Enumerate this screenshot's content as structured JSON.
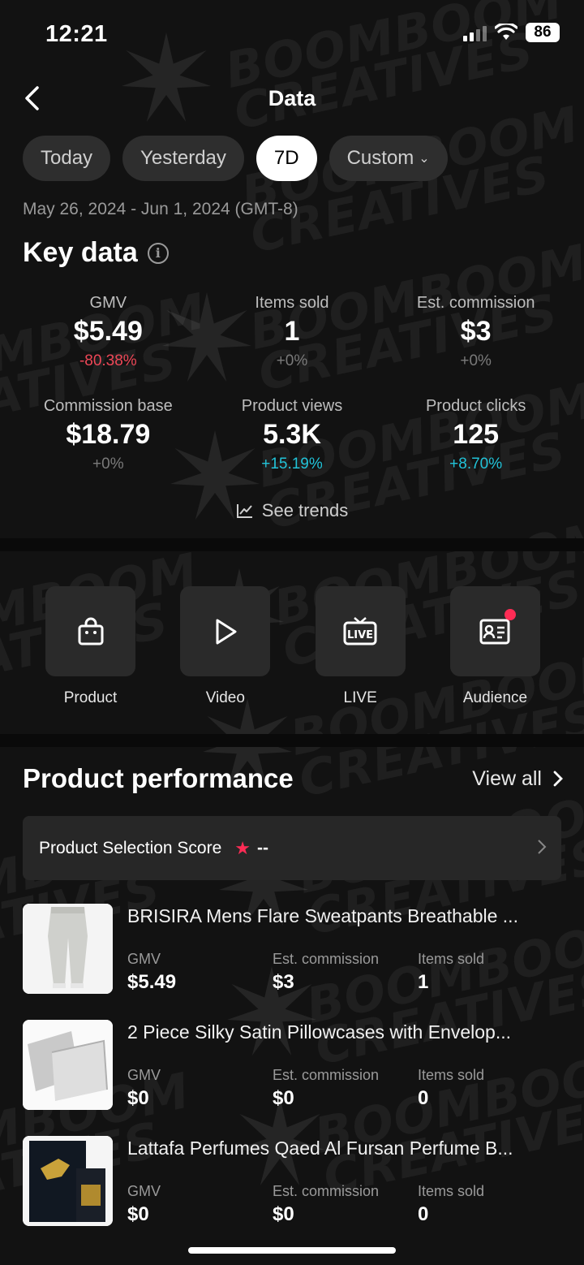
{
  "status_bar": {
    "time": "12:21",
    "battery": "86"
  },
  "header": {
    "title": "Data"
  },
  "tabs": [
    {
      "label": "Today",
      "active": false
    },
    {
      "label": "Yesterday",
      "active": false
    },
    {
      "label": "7D",
      "active": true
    },
    {
      "label": "Custom",
      "active": false
    }
  ],
  "date_range": "May 26, 2024 - Jun 1, 2024 (GMT-8)",
  "key_data": {
    "title": "Key data",
    "metrics": [
      {
        "label": "GMV",
        "value": "$5.49",
        "change": "-80.38%",
        "trend": "neg"
      },
      {
        "label": "Items sold",
        "value": "1",
        "change": "+0%",
        "trend": "flat"
      },
      {
        "label": "Est. commission",
        "value": "$3",
        "change": "+0%",
        "trend": "flat"
      },
      {
        "label": "Commission base",
        "value": "$18.79",
        "change": "+0%",
        "trend": "flat"
      },
      {
        "label": "Product views",
        "value": "5.3K",
        "change": "+15.19%",
        "trend": "pos"
      },
      {
        "label": "Product clicks",
        "value": "125",
        "change": "+8.70%",
        "trend": "pos"
      }
    ],
    "see_trends": "See trends"
  },
  "entries": [
    {
      "label": "Product",
      "icon": "shopping-bag-icon"
    },
    {
      "label": "Video",
      "icon": "play-icon"
    },
    {
      "label": "LIVE",
      "icon": "live-tv-icon"
    },
    {
      "label": "Audience",
      "icon": "id-card-icon"
    }
  ],
  "product_performance": {
    "title": "Product performance",
    "view_all": "View all",
    "score_label": "Product Selection Score",
    "score_value": "--",
    "stat_labels": {
      "gmv": "GMV",
      "commission": "Est. commission",
      "items": "Items sold"
    },
    "products": [
      {
        "name": "BRISIRA Mens Flare Sweatpants Breathable ...",
        "gmv": "$5.49",
        "commission": "$3",
        "items": "1"
      },
      {
        "name": "2 Piece Silky Satin Pillowcases with Envelop...",
        "gmv": "$0",
        "commission": "$0",
        "items": "0"
      },
      {
        "name": "Lattafa Perfumes Qaed Al Fursan Perfume B...",
        "gmv": "$0",
        "commission": "$0",
        "items": "0"
      }
    ]
  },
  "watermark": "BOOMBOOM CREATIVES",
  "colors": {
    "negative": "#ee4757",
    "positive": "#22c3d8",
    "accent": "#ff2c55",
    "background": "#121212"
  }
}
